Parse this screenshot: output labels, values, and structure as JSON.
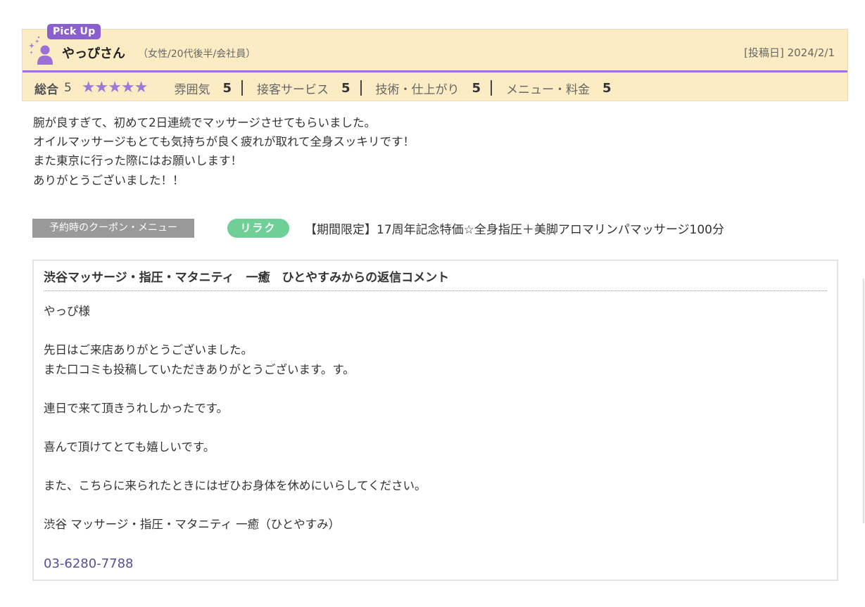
{
  "review": {
    "pickup_label": "Pick Up",
    "reviewer_name": "やっぴさん",
    "reviewer_attributes": "（女性/20代後半/会社員）",
    "post_date": "[投稿日] 2024/2/1",
    "overall_label": "総合",
    "overall_score": "5",
    "stars": "★★★★★",
    "star_rating": 5,
    "ratings": [
      {
        "label": "雰囲気",
        "score": "5"
      },
      {
        "label": "接客サービス",
        "score": "5"
      },
      {
        "label": "技術・仕上がり",
        "score": "5"
      },
      {
        "label": "メニュー・料金",
        "score": "5"
      }
    ],
    "body_lines": [
      "腕が良すぎて、初めて2日連続でマッサージさせてもらいました。",
      "オイルマッサージもとても気持ちが良く疲れが取れて全身スッキリです！",
      "また東京に行った際にはお願いします！",
      "ありがとうございました！！"
    ],
    "coupon_label": "予約時のクーポン・メニュー",
    "coupon_badge": "リラク",
    "coupon_name": "【期間限定】17周年記念特価☆全身指圧＋美脚アロマリンパマッサージ100分"
  },
  "reply": {
    "title": "渋谷マッサージ・指圧・マタニティ　一癒　ひとやすみからの返信コメント",
    "paragraphs": [
      [
        "やっぴ様"
      ],
      [
        "先日はご来店ありがとうございました。",
        "また口コミも投稿していただきありがとうございます。す。"
      ],
      [
        "連日で来て頂きうれしかったです。"
      ],
      [
        "喜んで頂けてとても嬉しいです。"
      ],
      [
        "また、こちらに来られたときにはぜひお身体を休めにいらしてください。"
      ],
      [
        "渋谷 マッサージ・指圧・マタニティ 一癒（ひとやすみ）"
      ]
    ],
    "phone": "03-6280-7788"
  },
  "colors": {
    "header_bg": "#fcecc4",
    "accent_purple": "#8b5fce",
    "star_purple": "#9b7ad6",
    "badge_green": "#6fcf97",
    "phone_link": "#5a4e96"
  },
  "icons": {
    "avatar": "user-avatar-icon",
    "sparkle": "sparkle-icon",
    "star": "star-icon"
  }
}
